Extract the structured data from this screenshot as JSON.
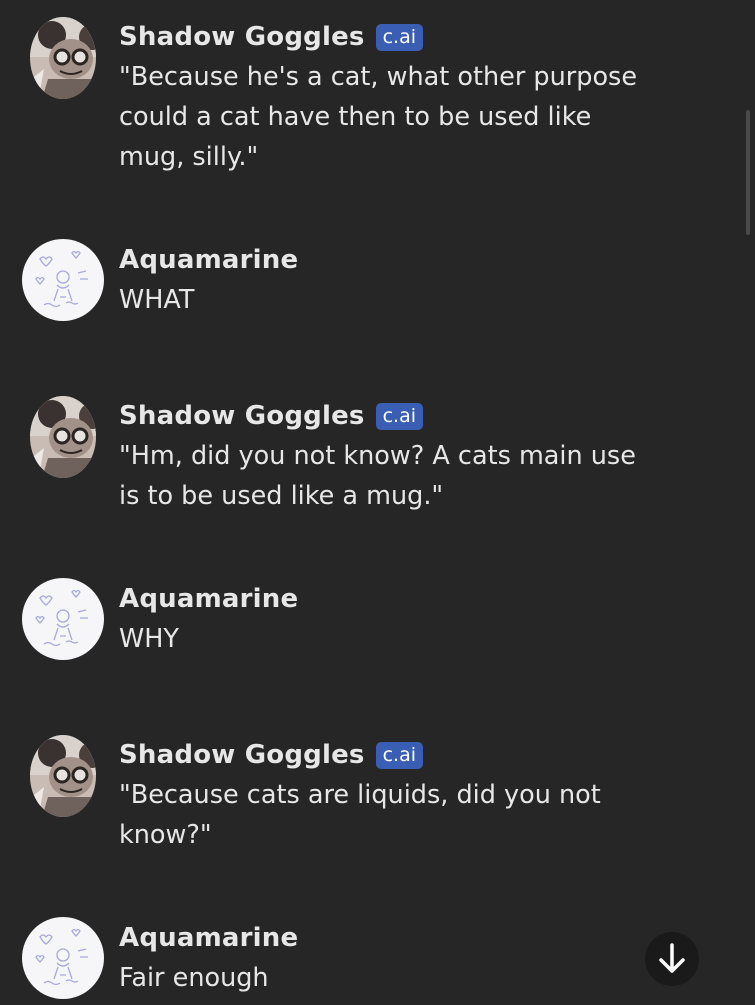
{
  "messages": [
    {
      "sender": "Shadow Goggles",
      "badge": "c.ai",
      "avatar": "character-avatar",
      "text": "\"Because he's a cat, what other purpose\ncould a cat have then to be used like\nmug, silly.\""
    },
    {
      "sender": "Aquamarine",
      "avatar": "user-avatar",
      "text": "WHAT"
    },
    {
      "sender": "Shadow Goggles",
      "badge": "c.ai",
      "avatar": "character-avatar",
      "text": "\"Hm, did you not know? A cats main use\nis to be used like a mug.\""
    },
    {
      "sender": "Aquamarine",
      "avatar": "user-avatar",
      "text": "WHY"
    },
    {
      "sender": "Shadow Goggles",
      "badge": "c.ai",
      "avatar": "character-avatar",
      "text": "\"Because cats are liquids, did you not\nknow?\""
    },
    {
      "sender": "Aquamarine",
      "avatar": "user-avatar",
      "text": "Fair enough"
    }
  ],
  "controls": {
    "scroll_down_icon": "arrow-down-icon"
  },
  "colors": {
    "background": "#262626",
    "text": "#e7e7e7",
    "badge": "#3a5eb4",
    "scroll_button": "#1a1a1a"
  }
}
